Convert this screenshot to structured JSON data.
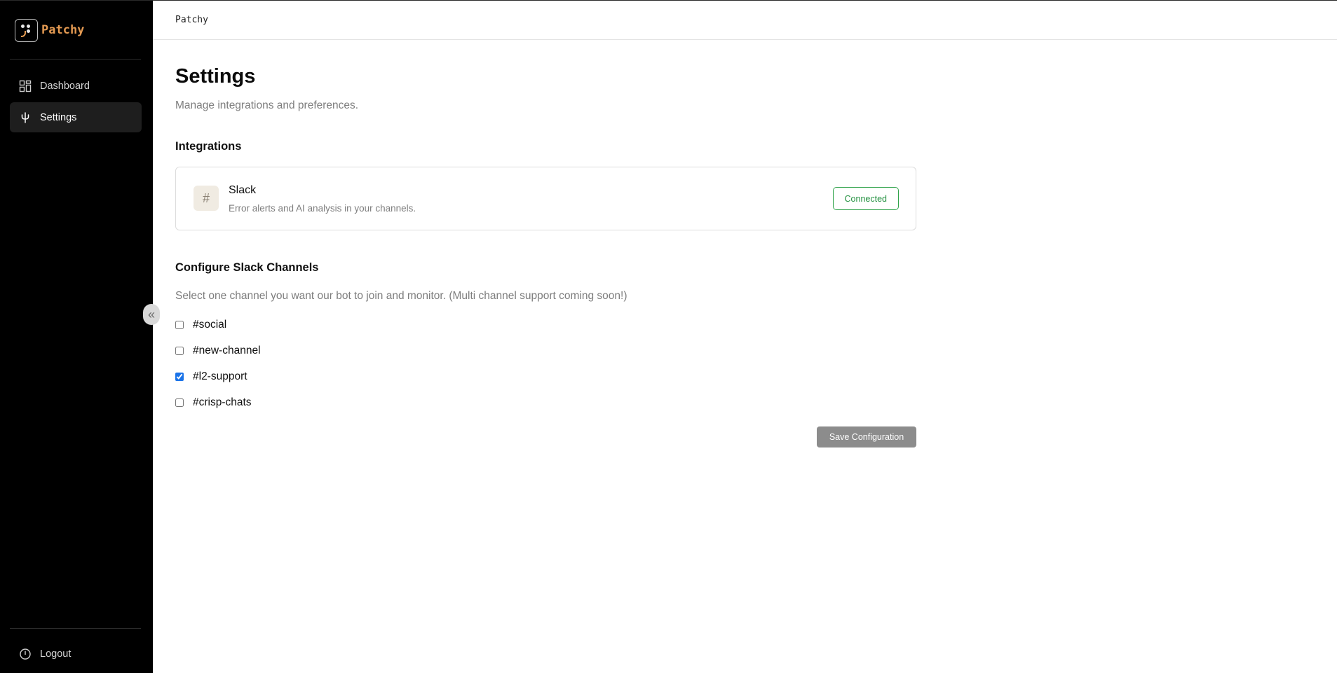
{
  "brand": {
    "name": "Patchy"
  },
  "sidebar": {
    "items": [
      {
        "label": "Dashboard",
        "icon": "dashboard-icon",
        "active": false
      },
      {
        "label": "Settings",
        "icon": "plug-icon",
        "active": true
      }
    ],
    "logout_label": "Logout"
  },
  "topbar": {
    "title": "Patchy"
  },
  "page": {
    "title": "Settings",
    "subtitle": "Manage integrations and preferences."
  },
  "integrations": {
    "heading": "Integrations",
    "items": [
      {
        "icon_glyph": "#",
        "name": "Slack",
        "description": "Error alerts and AI analysis in your channels.",
        "status": "Connected",
        "status_color": "#239140"
      }
    ]
  },
  "channels": {
    "heading": "Configure Slack Channels",
    "description": "Select one channel you want our bot to join and monitor. (Multi channel support coming soon!)",
    "options": [
      {
        "label": "#social",
        "checked": false
      },
      {
        "label": "#new-channel",
        "checked": false
      },
      {
        "label": "#l2-support",
        "checked": true
      },
      {
        "label": "#crisp-chats",
        "checked": false
      }
    ],
    "save_label": "Save Configuration"
  },
  "colors": {
    "sidebar_bg": "#000000",
    "brand_accent": "#e49a52",
    "checkbox_accent": "#1a73e8",
    "save_button_bg": "#8c8c8c"
  }
}
